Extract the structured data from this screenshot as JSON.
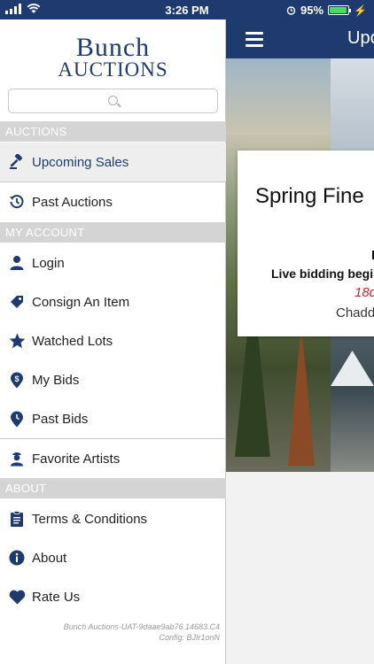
{
  "status_bar": {
    "time": "3:26 PM",
    "battery": "95%",
    "battery_level": 0.95
  },
  "navbar": {
    "title": "Upc"
  },
  "card": {
    "title": "Spring Fine",
    "line1": "I",
    "line2": "Live bidding begi",
    "line3": "18d",
    "line4": "Chadd"
  },
  "drawer": {
    "logo_line1": "Bunch",
    "logo_line2": "Auctions",
    "search_placeholder": "",
    "sections": {
      "auctions": "AUCTIONS",
      "my_account": "MY ACCOUNT",
      "about": "ABOUT"
    },
    "items": {
      "upcoming_sales": "Upcoming Sales",
      "past_auctions": "Past Auctions",
      "login": "Login",
      "consign": "Consign An Item",
      "watched": "Watched Lots",
      "my_bids": "My Bids",
      "past_bids": "Past Bids",
      "favorite_artists": "Favorite Artists",
      "terms": "Terms & Conditions",
      "about": "About",
      "rate": "Rate Us"
    },
    "footer_line1": "Bunch Auctions-UAT-9daae9ab76.14683.C4",
    "footer_line2": "Config: BJIr1onN"
  },
  "colors": {
    "brand": "#1f3a6e",
    "section_bg": "#d4d4d4",
    "accent_red": "#cc1e2e"
  }
}
